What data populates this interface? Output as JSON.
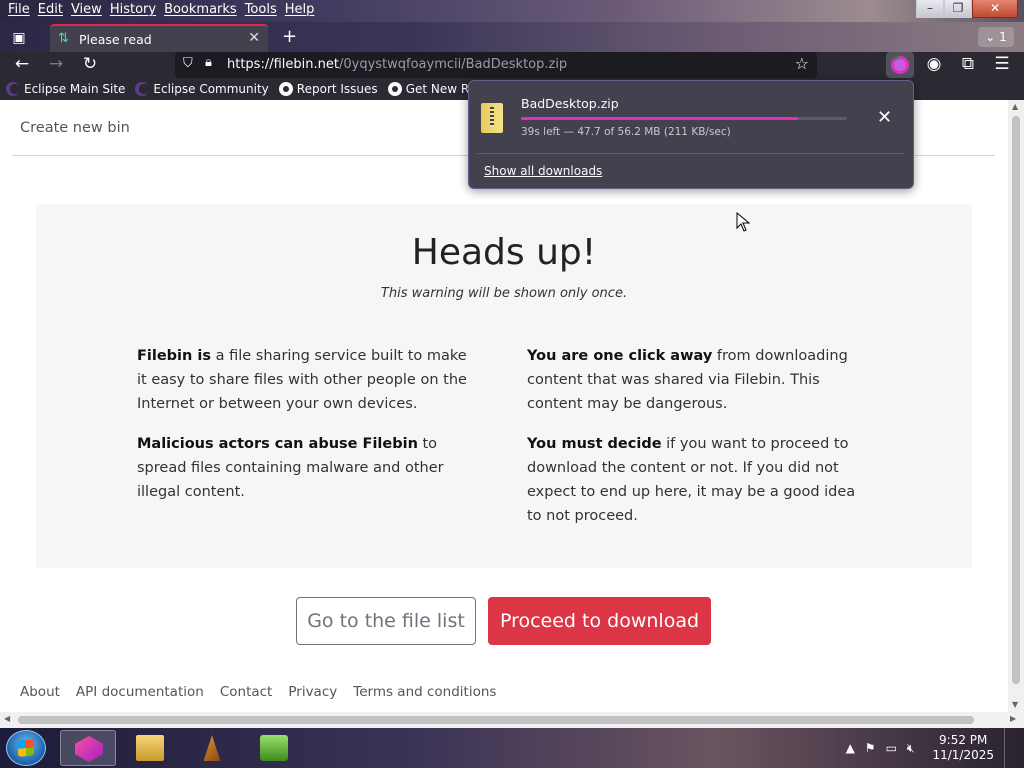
{
  "menubar": {
    "items": [
      "File",
      "Edit",
      "View",
      "History",
      "Bookmarks",
      "Tools",
      "Help"
    ]
  },
  "window_controls": {
    "minimize": "–",
    "maximize": "❐",
    "close": "✕"
  },
  "tabs": {
    "active_title": "Please read",
    "overflow_count": "1"
  },
  "navbar": {
    "url_host": "https://filebin.net",
    "url_path": "/0yqystwqfoaymcii/BadDesktop.zip"
  },
  "bookmarks": [
    {
      "label": "Eclipse Main Site",
      "icon": "eclipse-icon"
    },
    {
      "label": "Eclipse Community",
      "icon": "eclipse-icon"
    },
    {
      "label": "Report Issues",
      "icon": "github-icon"
    },
    {
      "label": "Get New Releases",
      "icon": "github-icon"
    }
  ],
  "page": {
    "create_bin": "Create new bin",
    "heading": "Heads up!",
    "subheading": "This warning will be shown only once.",
    "left": {
      "p1_bold": "Filebin is",
      "p1_rest": " a file sharing service built to make it easy to share files with other people on the Internet or between your own devices.",
      "p2_bold": "Malicious actors can abuse Filebin",
      "p2_rest": " to spread files containing malware and other illegal content."
    },
    "right": {
      "p1_bold": "You are one click away",
      "p1_rest": " from downloading content that was shared via Filebin. This content may be dangerous.",
      "p2_bold": "You must decide",
      "p2_rest": " if you want to proceed to download the content or not. If you did not expect to end up here, it may be a good idea to not proceed."
    },
    "btn_file_list": "Go to the file list",
    "btn_proceed": "Proceed to download",
    "footer": [
      "About",
      "API documentation",
      "Contact",
      "Privacy",
      "Terms and conditions"
    ]
  },
  "downloads": {
    "filename": "BadDesktop.zip",
    "status": "39s left — 47.7 of 56.2 MB (211 KB/sec)",
    "progress_fraction": 0.849,
    "show_all": "Show all downloads"
  },
  "taskbar": {
    "apps": [
      "firefox-icon",
      "file-explorer-icon",
      "vlc-icon",
      "notepad-plus-plus-icon"
    ],
    "time": "9:52 PM",
    "date": "11/1/2025"
  },
  "colors": {
    "accent_red": "#dc3545",
    "download_progress": "#e22fbf",
    "tab_accent": "#e22850"
  }
}
